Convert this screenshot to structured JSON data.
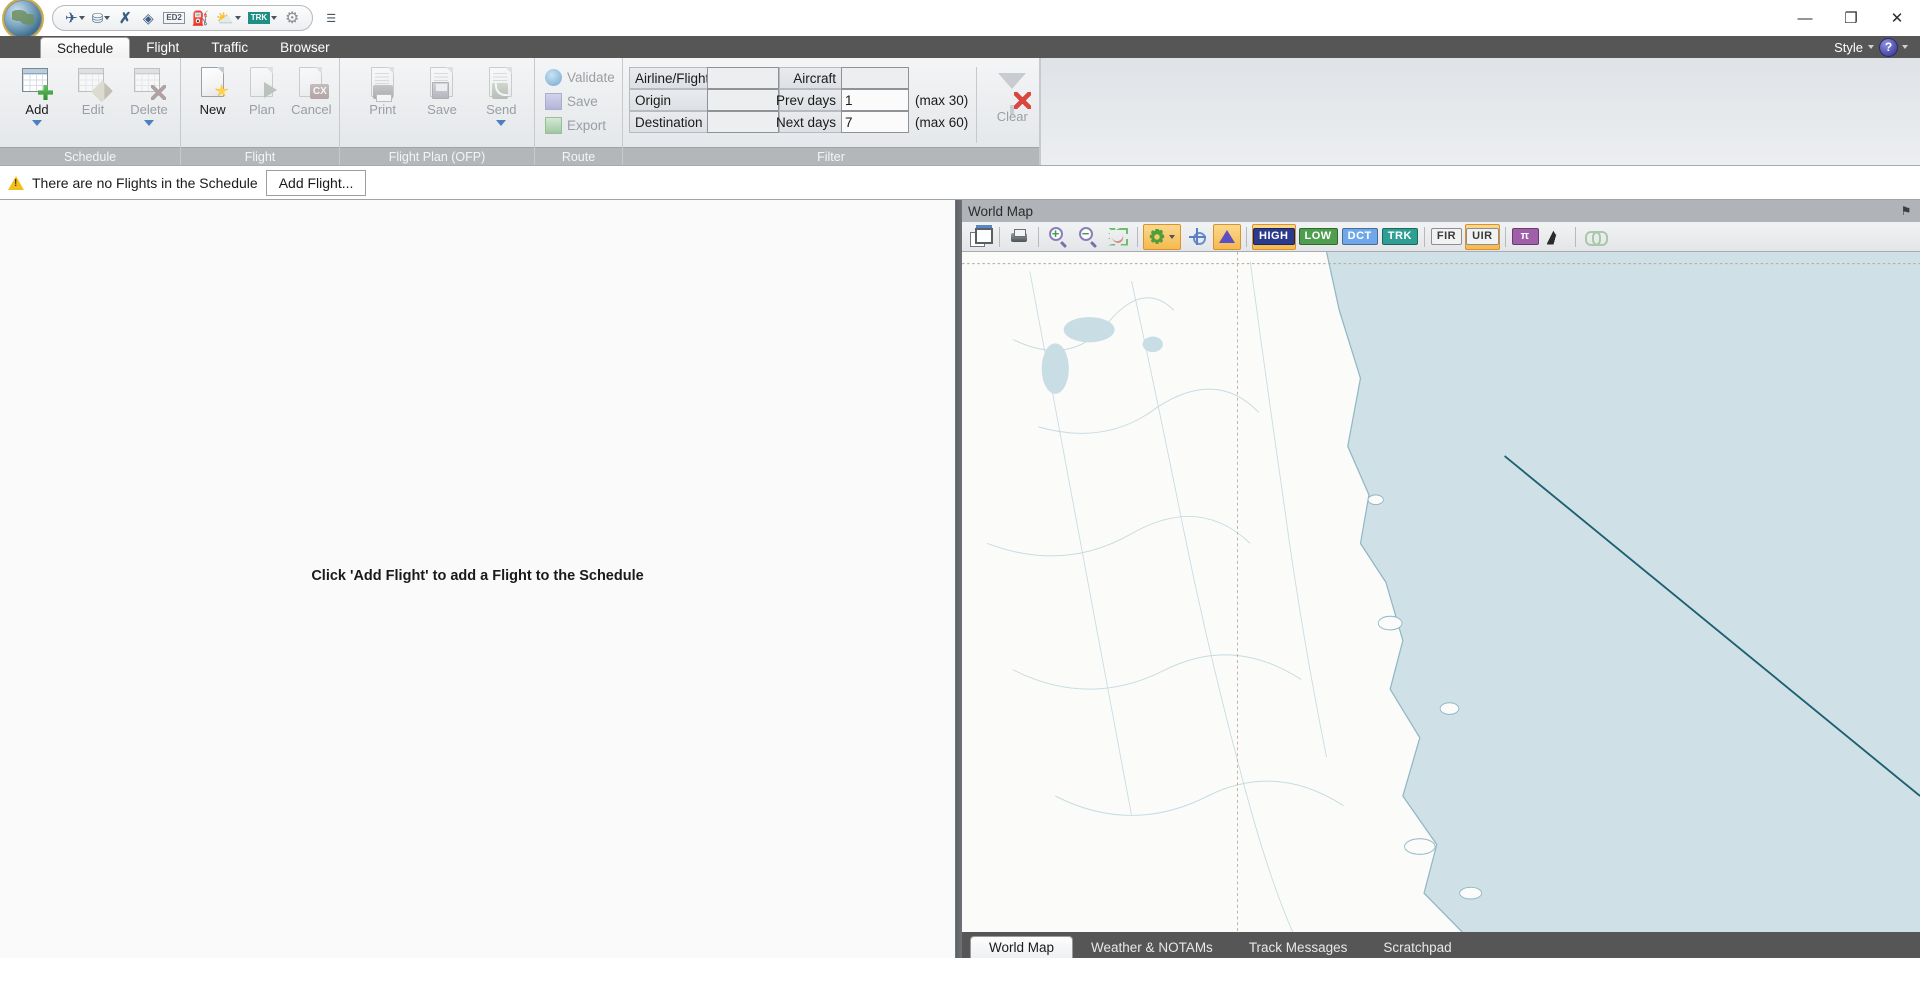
{
  "titlebar": {
    "app_icon": "globe-icon",
    "quick_access": [
      {
        "name": "aircraft-icon",
        "glyph": "✈",
        "has_caret": true,
        "color": "#3a5d82"
      },
      {
        "name": "database-icon",
        "glyph": "⛁",
        "has_caret": true,
        "color": "#5a7a92"
      },
      {
        "name": "route-cross-icon",
        "glyph": "✗",
        "has_caret": false,
        "color": "#3a5d82"
      },
      {
        "name": "layers-icon",
        "glyph": "◈",
        "has_caret": false,
        "color": "#3a5d82"
      },
      {
        "name": "ed2-icon",
        "glyph": "ED2",
        "has_caret": false,
        "color": "#4a5a6a"
      },
      {
        "name": "fuel-icon",
        "glyph": "⛽",
        "has_caret": false,
        "color": "#3c5a78"
      },
      {
        "name": "weather-icon",
        "glyph": "⛅",
        "has_caret": true,
        "color": "#b9a14a"
      },
      {
        "name": "trk-icon",
        "glyph": "TRK",
        "has_caret": true,
        "color": "#1f8f86"
      },
      {
        "name": "settings-gear-icon",
        "glyph": "⚙",
        "has_caret": false,
        "color": "#8a8f95"
      }
    ],
    "overflow_glyph": "☰",
    "window_controls": {
      "minimize": "—",
      "maximize": "❐",
      "close": "✕"
    }
  },
  "tabs": {
    "items": [
      {
        "label": "Schedule",
        "active": true
      },
      {
        "label": "Flight",
        "active": false
      },
      {
        "label": "Traffic",
        "active": false
      },
      {
        "label": "Browser",
        "active": false
      }
    ],
    "right": {
      "style_label": "Style",
      "help_glyph": "?"
    }
  },
  "ribbon": {
    "groups": [
      {
        "name": "schedule",
        "label": "Schedule",
        "buttons": [
          {
            "name": "add-button",
            "label": "Add",
            "enabled": true,
            "dropdown": true,
            "icon": "grid-plus-icon"
          },
          {
            "name": "edit-button",
            "label": "Edit",
            "enabled": false,
            "dropdown": false,
            "icon": "grid-pencil-icon"
          },
          {
            "name": "delete-button",
            "label": "Delete",
            "enabled": false,
            "dropdown": true,
            "icon": "grid-x-icon"
          }
        ]
      },
      {
        "name": "flight",
        "label": "Flight",
        "buttons": [
          {
            "name": "new-button",
            "label": "New",
            "enabled": true,
            "dropdown": false,
            "icon": "doc-star-icon"
          },
          {
            "name": "plan-button",
            "label": "Plan",
            "enabled": false,
            "dropdown": false,
            "icon": "doc-play-icon"
          },
          {
            "name": "cancel-button",
            "label": "Cancel",
            "enabled": false,
            "dropdown": false,
            "icon": "doc-cx-icon"
          }
        ]
      },
      {
        "name": "flight-plan-ofp",
        "label": "Flight Plan (OFP)",
        "buttons": [
          {
            "name": "print-button",
            "label": "Print",
            "enabled": false,
            "dropdown": false,
            "icon": "doc-printer-icon"
          },
          {
            "name": "save-ofp-button",
            "label": "Save",
            "enabled": false,
            "dropdown": false,
            "icon": "doc-disk-icon"
          },
          {
            "name": "send-button",
            "label": "Send",
            "enabled": false,
            "dropdown": true,
            "icon": "doc-rss-icon"
          }
        ]
      },
      {
        "name": "route",
        "label": "Route",
        "small_buttons": [
          {
            "name": "validate-button",
            "label": "Validate",
            "enabled": false,
            "icon": "ie-globe-icon"
          },
          {
            "name": "save-route-button",
            "label": "Save",
            "enabled": false,
            "icon": "floppy-icon"
          },
          {
            "name": "export-button",
            "label": "Export",
            "enabled": false,
            "icon": "spreadsheet-icon"
          }
        ]
      },
      {
        "name": "filter",
        "label": "Filter",
        "fields_left": [
          {
            "name": "airline-flight-field",
            "label": "Airline/Flight",
            "value": ""
          },
          {
            "name": "origin-field",
            "label": "Origin",
            "value": ""
          },
          {
            "name": "destination-field",
            "label": "Destination",
            "value": ""
          }
        ],
        "fields_right": [
          {
            "name": "aircraft-field",
            "label": "Aircraft",
            "value": "",
            "hint": ""
          },
          {
            "name": "prev-days-field",
            "label": "Prev days",
            "value": "1",
            "hint": "(max 30)"
          },
          {
            "name": "next-days-field",
            "label": "Next days",
            "value": "7",
            "hint": "(max 60)"
          }
        ],
        "clear_button": {
          "name": "clear-filter-button",
          "label": "Clear",
          "enabled": false
        }
      }
    ]
  },
  "notification": {
    "icon": "warning-icon",
    "message": "There are no Flights in the Schedule",
    "action_label": "Add Flight..."
  },
  "left_pane": {
    "empty_message": "Click 'Add Flight' to add a Flight to the Schedule"
  },
  "map_panel": {
    "title": "World Map",
    "pin_glyph": "⚑",
    "toolbar": [
      {
        "name": "new-window-icon",
        "kind": "icon",
        "icon": "new-window-icon",
        "active": false
      },
      {
        "name": "print-map-icon",
        "kind": "icon",
        "icon": "printer-icon",
        "active": false
      },
      {
        "name": "zoom-in-icon",
        "kind": "icon",
        "icon": "zoom-in-icon",
        "active": false
      },
      {
        "name": "zoom-out-icon",
        "kind": "icon",
        "icon": "zoom-out-icon",
        "active": false
      },
      {
        "name": "fit-route-icon",
        "kind": "icon",
        "icon": "fit-to-route-icon",
        "active": false
      },
      {
        "name": "map-settings-icon",
        "kind": "icon",
        "icon": "gear-icon",
        "active": true,
        "caret": true
      },
      {
        "name": "center-target-icon",
        "kind": "icon",
        "icon": "crosshair-icon",
        "active": false
      },
      {
        "name": "waypoint-icon",
        "kind": "icon",
        "icon": "triangle-waypoint-icon",
        "active": true
      },
      {
        "name": "high-airways-button",
        "kind": "tag",
        "label": "HIGH",
        "style": "tag-high",
        "active": true
      },
      {
        "name": "low-airways-button",
        "kind": "tag",
        "label": "LOW",
        "style": "tag-low",
        "active": false
      },
      {
        "name": "direct-routes-button",
        "kind": "tag",
        "label": "DCT",
        "style": "tag-dct",
        "active": false
      },
      {
        "name": "tracks-button",
        "kind": "tag",
        "label": "TRK",
        "style": "tag-trk",
        "active": false
      },
      {
        "name": "fir-boundaries-button",
        "kind": "tag",
        "label": "FIR",
        "style": "tag-fir",
        "active": false
      },
      {
        "name": "uir-boundaries-button",
        "kind": "tag",
        "label": "UIR",
        "style": "tag-uir",
        "active": true
      },
      {
        "name": "pi-points-button",
        "kind": "tag",
        "label": "π",
        "style": "tag-pi",
        "active": false
      },
      {
        "name": "terrain-icon",
        "kind": "icon",
        "icon": "terrain-icon",
        "active": false
      },
      {
        "name": "chain-link-icon",
        "kind": "icon",
        "icon": "chain-link-icon",
        "active": false
      }
    ]
  },
  "bottom_tabs": {
    "items": [
      {
        "label": "World Map",
        "active": true
      },
      {
        "label": "Weather & NOTAMs",
        "active": false
      },
      {
        "label": "Track Messages",
        "active": false
      },
      {
        "label": "Scratchpad",
        "active": false
      }
    ]
  }
}
